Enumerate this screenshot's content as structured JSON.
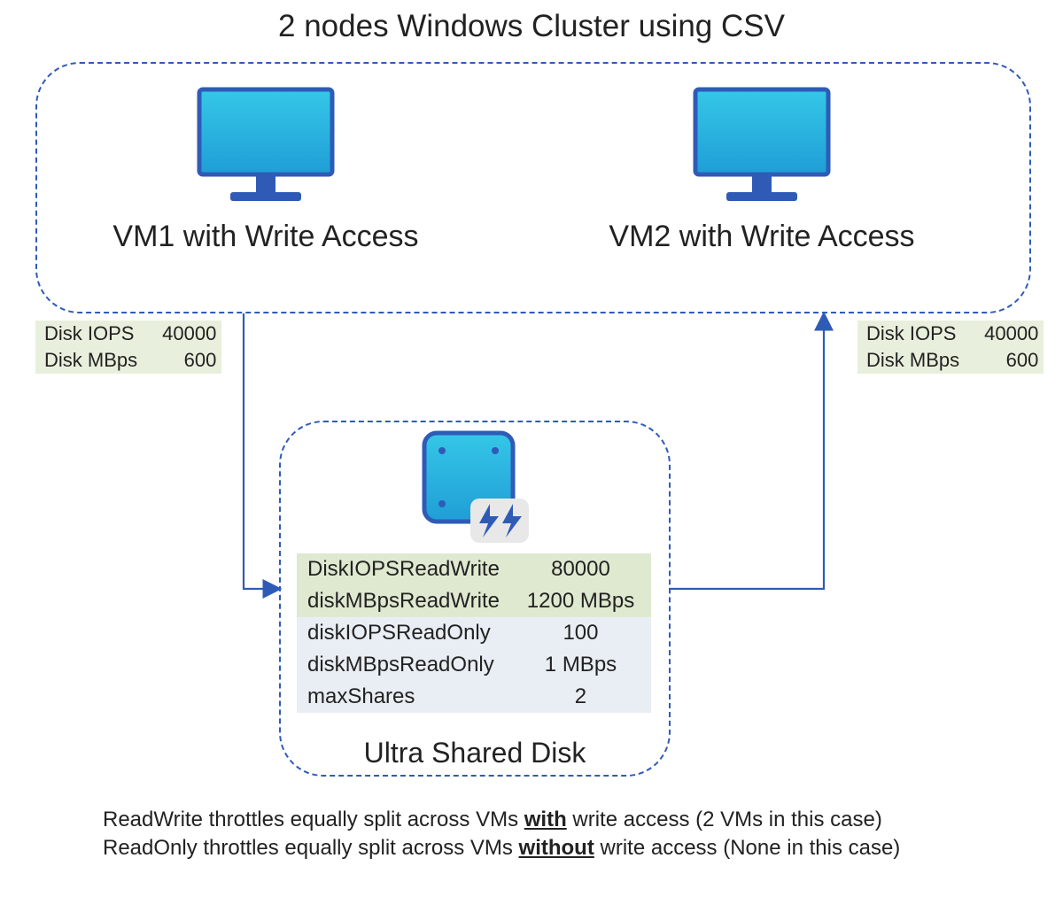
{
  "title": "2 nodes Windows Cluster using CSV",
  "vm1": {
    "label": "VM1 with Write Access",
    "stats": {
      "iops_label": "Disk IOPS",
      "iops_value": "40000",
      "mbps_label": "Disk MBps",
      "mbps_value": "600"
    }
  },
  "vm2": {
    "label": "VM2 with Write Access",
    "stats": {
      "iops_label": "Disk IOPS",
      "iops_value": "40000",
      "mbps_label": "Disk MBps",
      "mbps_value": "600"
    }
  },
  "disk": {
    "title": "Ultra Shared Disk",
    "rows": [
      {
        "k": "DiskIOPSReadWrite",
        "v": "80000"
      },
      {
        "k": "diskMBpsReadWrite",
        "v": "1200 MBps"
      },
      {
        "k": "diskIOPSReadOnly",
        "v": "100"
      },
      {
        "k": "diskMBpsReadOnly",
        "v": "1 MBps"
      },
      {
        "k": "maxShares",
        "v": "2"
      }
    ]
  },
  "notes": {
    "line1_pre": "ReadWrite throttles equally split across VMs ",
    "line1_em": "with",
    "line1_post": " write access (2 VMs in this case)",
    "line2_pre": "ReadOnly throttles equally split across VMs ",
    "line2_em": "without",
    "line2_post": " write access (None in this case)"
  }
}
